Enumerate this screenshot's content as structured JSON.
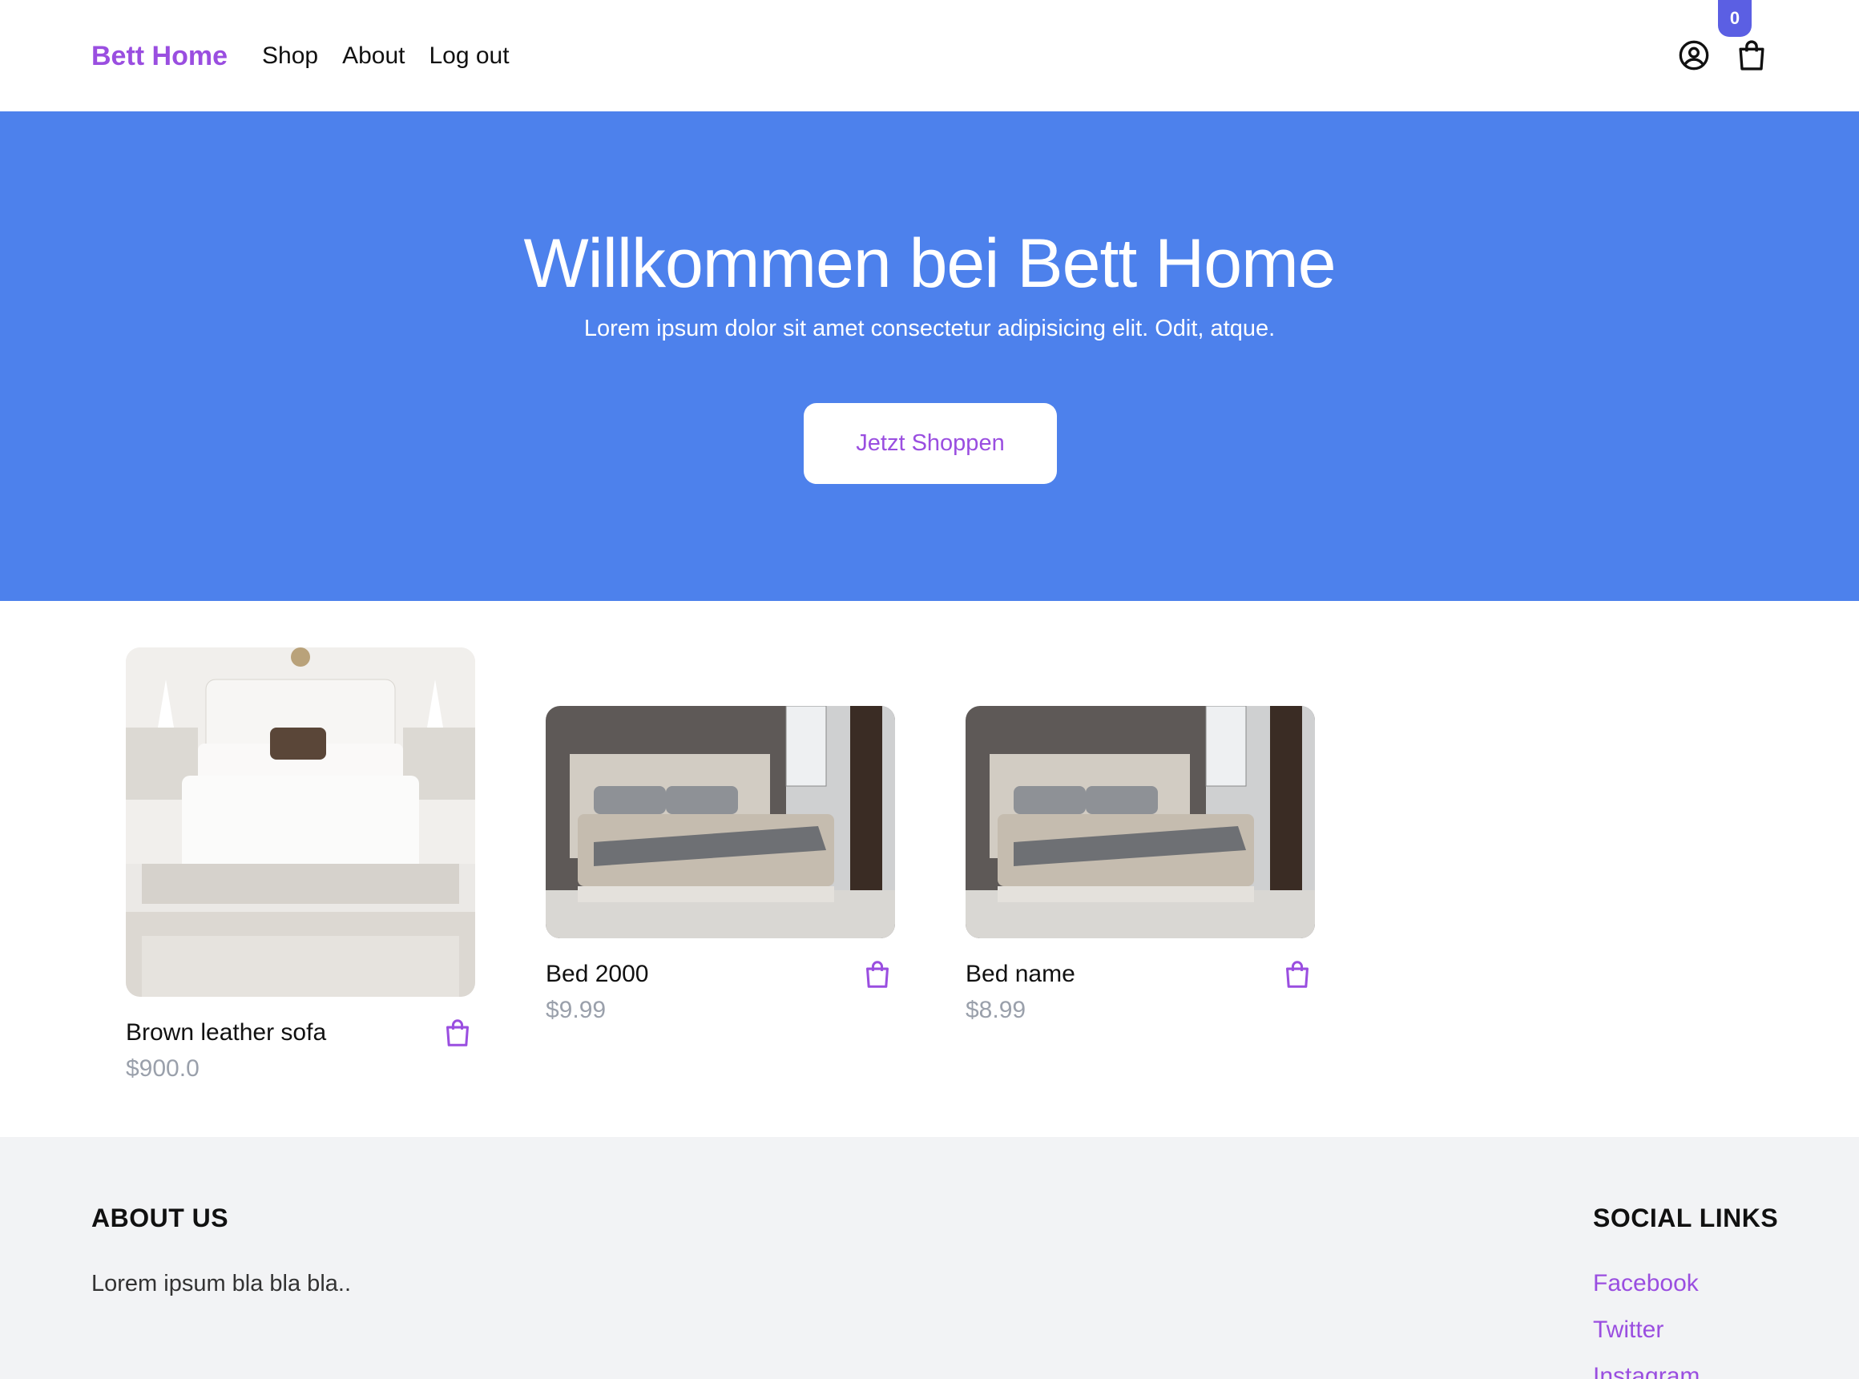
{
  "header": {
    "brand": "Bett Home",
    "nav": [
      {
        "label": "Shop"
      },
      {
        "label": "About"
      },
      {
        "label": "Log out"
      }
    ],
    "cart_count": "0",
    "icons": {
      "account": "user-circle-icon",
      "cart": "shopping-bag-icon"
    }
  },
  "hero": {
    "title": "Willkommen bei Bett Home",
    "subtitle": "Lorem ipsum dolor sit amet consectetur adipisicing elit. Odit, atque.",
    "cta": "Jetzt Shoppen",
    "background": "#4d81ec"
  },
  "products": [
    {
      "name": "Brown leather sofa",
      "price": "$900.0",
      "image": "white-bedroom-photo"
    },
    {
      "name": "Bed 2000",
      "price": "$9.99",
      "image": "grey-bed-photo"
    },
    {
      "name": "Bed name",
      "price": "$8.99",
      "image": "grey-bed-photo"
    }
  ],
  "footer": {
    "about_heading": "ABOUT US",
    "about_text": "Lorem ipsum bla bla bla..",
    "social_heading": "SOCIAL LINKS",
    "social_links": [
      {
        "label": "Facebook"
      },
      {
        "label": "Twitter"
      },
      {
        "label": "Instagram"
      }
    ]
  },
  "colors": {
    "accent": "#9a4ee0",
    "badge": "#5b5fe3",
    "price": "#9aa0ab",
    "footer_bg": "#f2f3f5"
  }
}
